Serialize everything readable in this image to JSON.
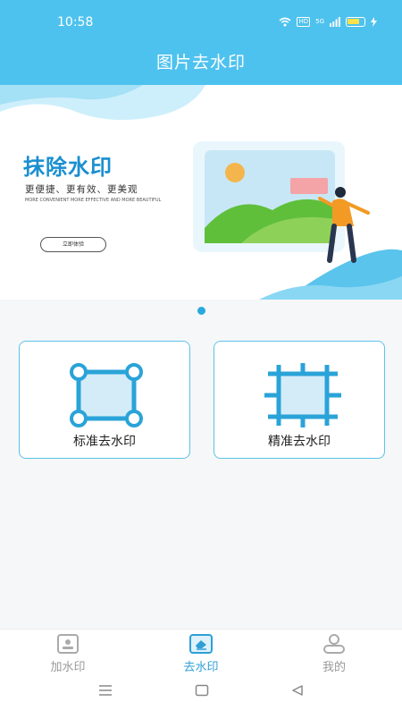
{
  "status_bar": {
    "time": "10:58",
    "hd_label": "HD",
    "network_label": "5G",
    "icons": [
      "wifi-icon",
      "hd-icon",
      "signal-icon",
      "battery-icon",
      "charging-icon"
    ]
  },
  "header": {
    "title": "图片去水印"
  },
  "banner": {
    "heading": "抹除水印",
    "subtitle": "更便捷、更有效、更美观",
    "english_text": "MORE CONVENIENT MORE EFFECTIVE AND MORE BEAUTIFUL",
    "button_label": "立即体验",
    "active_slide": 1,
    "slide_count": 1
  },
  "cards": [
    {
      "label": "标准去水印",
      "icon": "standard-crop-icon"
    },
    {
      "label": "精准去水印",
      "icon": "precise-crop-icon"
    }
  ],
  "bottom_nav": {
    "items": [
      {
        "label": "加水印",
        "icon": "add-watermark-icon",
        "active": false
      },
      {
        "label": "去水印",
        "icon": "remove-watermark-icon",
        "active": true
      },
      {
        "label": "我的",
        "icon": "profile-icon",
        "active": false
      }
    ]
  },
  "system_nav": {
    "icons": [
      "menu-icon",
      "home-icon",
      "back-icon"
    ]
  },
  "colors": {
    "primary": "#4ec2ee",
    "accent": "#29a9df",
    "active_tab": "#2f9fd6",
    "inactive_tab": "#999999",
    "card_border": "#5cc2e8"
  }
}
